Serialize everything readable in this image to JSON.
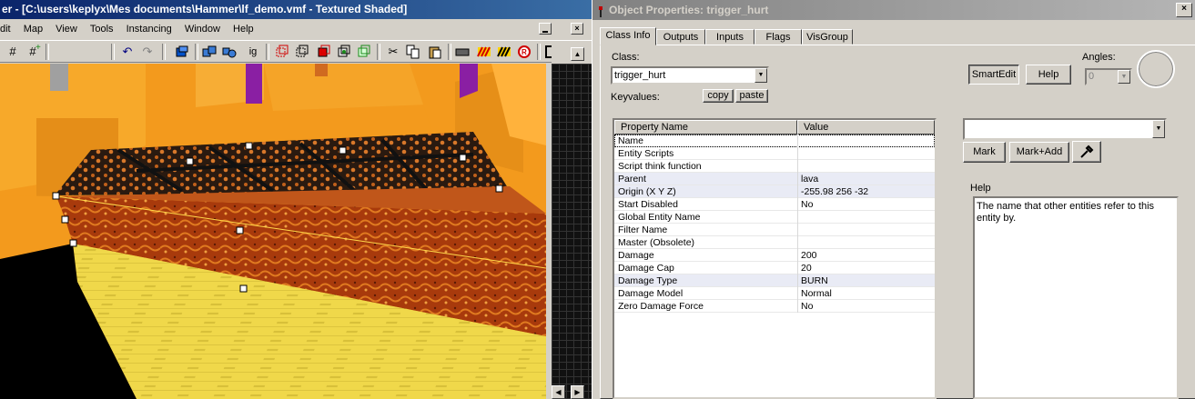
{
  "hammer": {
    "title": "er - [C:\\users\\keplyx\\Mes documents\\Hammer\\lf_demo.vmf - Textured Shaded]",
    "menu": [
      "dit",
      "Map",
      "View",
      "Tools",
      "Instancing",
      "Window",
      "Help"
    ],
    "toolbar_icons": [
      "grid-icon",
      "grid-toggle-icon",
      "undo-icon",
      "redo-icon",
      "carve-icon",
      "group-icon",
      "ungroup-icon",
      "ignore-group-icon",
      "hide-icon",
      "show-icon",
      "cut-icon",
      "copy-icon",
      "paste-icon",
      "texture-icon",
      "null-texture-icon",
      "run-map-icon"
    ],
    "toolbar_text": "ig"
  },
  "props": {
    "title": "Object Properties: trigger_hurt",
    "tabs": [
      "Class Info",
      "Outputs",
      "Inputs",
      "Flags",
      "VisGroup"
    ],
    "active_tab": "Class Info",
    "class_label": "Class:",
    "class_value": "trigger_hurt",
    "keyvalues_label": "Keyvalues:",
    "copy_label": "copy",
    "paste_label": "paste",
    "smartedit_label": "SmartEdit",
    "help_button_label": "Help",
    "angles_label": "Angles:",
    "angles_value": "0",
    "columns": [
      "Property Name",
      "Value"
    ],
    "rows": [
      {
        "name": "Name",
        "value": ""
      },
      {
        "name": "Entity Scripts",
        "value": ""
      },
      {
        "name": "Script think function",
        "value": ""
      },
      {
        "name": "Parent",
        "value": "lava"
      },
      {
        "name": "Origin (X Y Z)",
        "value": "-255.98 256 -32"
      },
      {
        "name": "Start Disabled",
        "value": "No"
      },
      {
        "name": "Global Entity Name",
        "value": ""
      },
      {
        "name": "Filter Name",
        "value": ""
      },
      {
        "name": "Master (Obsolete)",
        "value": ""
      },
      {
        "name": "Damage",
        "value": "200"
      },
      {
        "name": "Damage Cap",
        "value": "20"
      },
      {
        "name": "Damage Type",
        "value": "BURN"
      },
      {
        "name": "Damage Model",
        "value": "Normal"
      },
      {
        "name": "Zero Damage Force",
        "value": "No"
      }
    ],
    "value_editor": "",
    "mark_label": "Mark",
    "mark_add_label": "Mark+Add",
    "help_section_label": "Help",
    "help_text": "The name that other entities refer to this entity by."
  }
}
